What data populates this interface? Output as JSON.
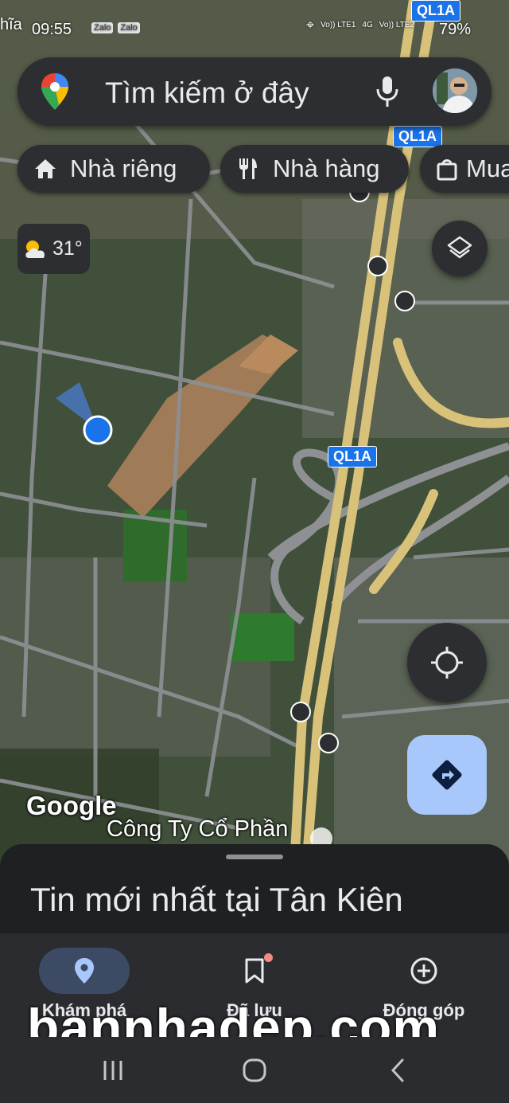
{
  "status_bar": {
    "time": "09:55",
    "left_icons": [
      "Zalo",
      "Zalo"
    ],
    "network_1": "Vo)) LTE1",
    "network_type": "4G",
    "network_2": "Vo)) LTE2",
    "battery": "79%",
    "partial_text": "hĩa"
  },
  "search": {
    "placeholder": "Tìm kiếm ở đây"
  },
  "chips": {
    "home": "Nhà riêng",
    "restaurant": "Nhà hàng",
    "shopping": "Mua"
  },
  "weather": {
    "temperature": "31°"
  },
  "map": {
    "road_badges": [
      "QL1A",
      "QL1A",
      "QL1A"
    ],
    "google_logo": "Google",
    "place_label": "Công Ty Cổ Phần"
  },
  "sheet": {
    "title": "Tin mới nhất tại Tân Kiên"
  },
  "bottom_nav": {
    "explore": "Khám phá",
    "saved": "Đã lưu",
    "contribute": "Đóng góp"
  },
  "watermark": "bannhadep.com",
  "colors": {
    "surface": "#2d2e31",
    "accent": "#a8c7fa",
    "location_dot": "#1a73e8",
    "highway": "#d8c27a"
  }
}
